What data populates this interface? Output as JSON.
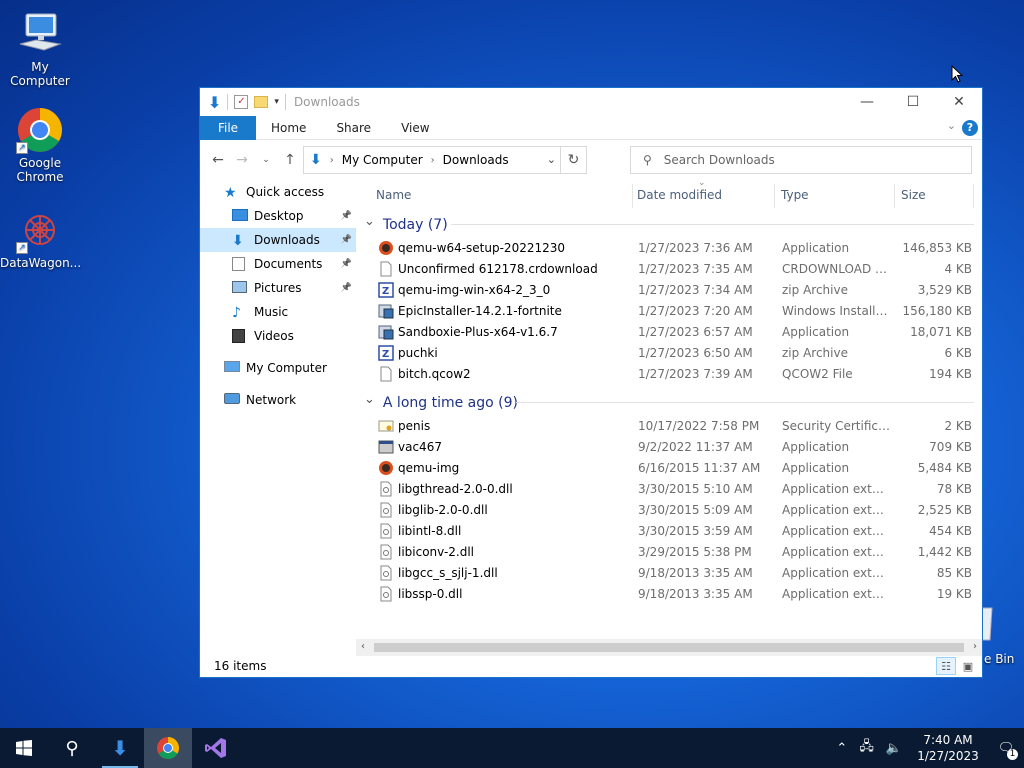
{
  "desktop": {
    "icons": [
      {
        "label": "My Computer"
      },
      {
        "label": "Google Chrome"
      },
      {
        "label": "DataWagon..."
      }
    ],
    "recycle_bin_partial": "e Bin"
  },
  "window": {
    "title": "Downloads",
    "ribbon": {
      "file": "File",
      "tabs": [
        "Home",
        "Share",
        "View"
      ],
      "help": "?"
    },
    "breadcrumb": [
      "My Computer",
      "Downloads"
    ],
    "search_placeholder": "Search Downloads",
    "sidebar": [
      {
        "label": "Quick access",
        "icon": "star-icon"
      },
      {
        "label": "Desktop",
        "icon": "desktop-folder-icon",
        "pinned": true
      },
      {
        "label": "Downloads",
        "icon": "downloads-folder-icon",
        "pinned": true,
        "selected": true
      },
      {
        "label": "Documents",
        "icon": "documents-folder-icon",
        "pinned": true
      },
      {
        "label": "Pictures",
        "icon": "pictures-folder-icon",
        "pinned": true
      },
      {
        "label": "Music",
        "icon": "music-icon"
      },
      {
        "label": "Videos",
        "icon": "videos-icon"
      },
      {
        "label": "My Computer",
        "icon": "computer-icon"
      },
      {
        "label": "Network",
        "icon": "network-icon"
      }
    ],
    "columns": [
      "Name",
      "Date modified",
      "Type",
      "Size"
    ],
    "groups": [
      {
        "label": "Today (7)",
        "files": [
          {
            "name": "qemu-w64-setup-20221230",
            "date": "1/27/2023 7:36 AM",
            "type": "Application",
            "size": "146,853 KB",
            "icon": "qemu-app-icon"
          },
          {
            "name": "Unconfirmed 612178.crdownload",
            "date": "1/27/2023 7:35 AM",
            "type": "CRDOWNLOAD File",
            "size": "4 KB",
            "icon": "blank-file-icon"
          },
          {
            "name": "qemu-img-win-x64-2_3_0",
            "date": "1/27/2023 7:34 AM",
            "type": "zip Archive",
            "size": "3,529 KB",
            "icon": "zip-archive-icon"
          },
          {
            "name": "EpicInstaller-14.2.1-fortnite",
            "date": "1/27/2023 7:20 AM",
            "type": "Windows Installer ...",
            "size": "156,180 KB",
            "icon": "installer-icon"
          },
          {
            "name": "Sandboxie-Plus-x64-v1.6.7",
            "date": "1/27/2023 6:57 AM",
            "type": "Application",
            "size": "18,071 KB",
            "icon": "installer-icon"
          },
          {
            "name": "puchki",
            "date": "1/27/2023 6:50 AM",
            "type": "zip Archive",
            "size": "6 KB",
            "icon": "zip-archive-icon"
          },
          {
            "name": "bitch.qcow2",
            "date": "1/27/2023 7:39 AM",
            "type": "QCOW2 File",
            "size": "194 KB",
            "icon": "blank-file-icon"
          }
        ]
      },
      {
        "label": "A long time ago (9)",
        "files": [
          {
            "name": "penis",
            "date": "10/17/2022 7:58 PM",
            "type": "Security Certificate",
            "size": "2 KB",
            "icon": "certificate-icon"
          },
          {
            "name": "vac467",
            "date": "9/2/2022 11:37 AM",
            "type": "Application",
            "size": "709 KB",
            "icon": "app-window-icon"
          },
          {
            "name": "qemu-img",
            "date": "6/16/2015 11:37 AM",
            "type": "Application",
            "size": "5,484 KB",
            "icon": "qemu-app-icon"
          },
          {
            "name": "libgthread-2.0-0.dll",
            "date": "3/30/2015 5:10 AM",
            "type": "Application exten...",
            "size": "78 KB",
            "icon": "dll-file-icon"
          },
          {
            "name": "libglib-2.0-0.dll",
            "date": "3/30/2015 5:09 AM",
            "type": "Application exten...",
            "size": "2,525 KB",
            "icon": "dll-file-icon"
          },
          {
            "name": "libintl-8.dll",
            "date": "3/30/2015 3:59 AM",
            "type": "Application exten...",
            "size": "454 KB",
            "icon": "dll-file-icon"
          },
          {
            "name": "libiconv-2.dll",
            "date": "3/29/2015 5:38 PM",
            "type": "Application exten...",
            "size": "1,442 KB",
            "icon": "dll-file-icon"
          },
          {
            "name": "libgcc_s_sjlj-1.dll",
            "date": "9/18/2013 3:35 AM",
            "type": "Application exten...",
            "size": "85 KB",
            "icon": "dll-file-icon"
          },
          {
            "name": "libssp-0.dll",
            "date": "9/18/2013 3:35 AM",
            "type": "Application exten...",
            "size": "19 KB",
            "icon": "dll-file-icon"
          }
        ]
      }
    ],
    "status": "16 items"
  },
  "taskbar": {
    "apps": [
      "start-icon",
      "search-icon",
      "downloads-app-icon",
      "chrome-icon",
      "visual-studio-icon"
    ],
    "time": "7:40 AM",
    "date": "1/27/2023",
    "notifications": "1"
  },
  "colors": {
    "accent": "#1979ca",
    "selected": "#cce8ff",
    "group_header": "#1e3287",
    "taskbar": "#0a1a33"
  }
}
